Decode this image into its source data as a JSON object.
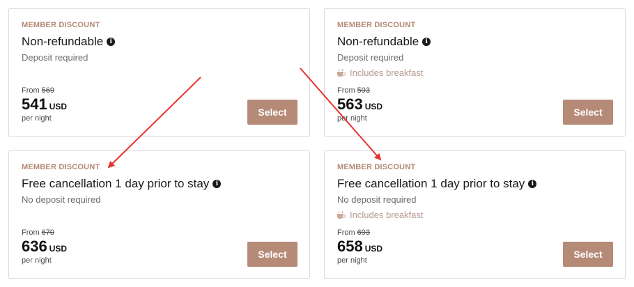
{
  "cards": [
    {
      "badge": "MEMBER DISCOUNT",
      "title": "Non-refundable",
      "subtitle": "Deposit required",
      "amenity": "",
      "from_label": "From",
      "original_price": "569",
      "price": "541",
      "currency": "USD",
      "per_night": "per night",
      "button": "Select"
    },
    {
      "badge": "MEMBER DISCOUNT",
      "title": "Non-refundable",
      "subtitle": "Deposit required",
      "amenity": "Includes breakfast",
      "from_label": "From",
      "original_price": "593",
      "price": "563",
      "currency": "USD",
      "per_night": "per night",
      "button": "Select"
    },
    {
      "badge": "MEMBER DISCOUNT",
      "title": "Free cancellation 1 day prior to stay",
      "subtitle": "No deposit required",
      "amenity": "",
      "from_label": "From",
      "original_price": "670",
      "price": "636",
      "currency": "USD",
      "per_night": "per night",
      "button": "Select"
    },
    {
      "badge": "MEMBER DISCOUNT",
      "title": "Free cancellation 1 day prior to stay",
      "subtitle": "No deposit required",
      "amenity": "Includes breakfast",
      "from_label": "From",
      "original_price": "693",
      "price": "658",
      "currency": "USD",
      "per_night": "per night",
      "button": "Select"
    }
  ],
  "colors": {
    "accent": "#b58a77",
    "badge": "#b48873",
    "annotation_arrow": "#e8322e"
  },
  "icons": {
    "info": "info-icon",
    "breakfast": "coffee-cup-icon"
  }
}
